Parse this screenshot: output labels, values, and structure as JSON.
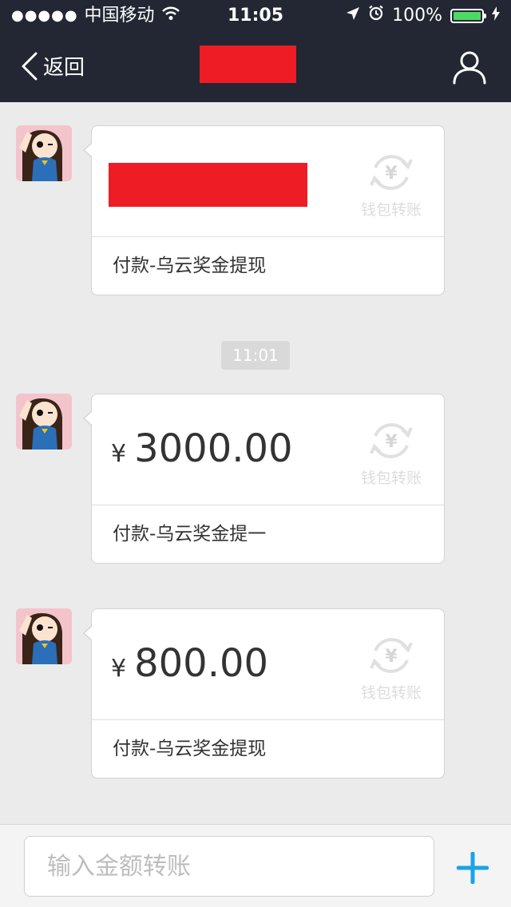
{
  "status_bar": {
    "signal": "●●●●●",
    "carrier": "中国移动",
    "time": "11:05",
    "battery_percent": "100%",
    "battery_level": 1.0,
    "battery_color": "#4cd964"
  },
  "nav": {
    "back_label": "返回",
    "title_redacted": true,
    "profile_icon": "person-icon",
    "background": "#232734"
  },
  "messages": [
    {
      "amount_yen": "",
      "amount": "",
      "redacted": true,
      "note": "付款-乌云奖金提现",
      "watermark": "钱包转账"
    },
    {
      "amount_yen": "¥",
      "amount": "3000.00",
      "redacted": false,
      "note": "付款-乌云奖金提一",
      "watermark": "钱包转账"
    },
    {
      "amount_yen": "¥",
      "amount": "800.00",
      "redacted": false,
      "note": "付款-乌云奖金提现",
      "watermark": "钱包转账"
    }
  ],
  "timestamp_chip": "11:01",
  "composer": {
    "placeholder": "输入金额转账",
    "value": "",
    "plus_icon": "plus-icon",
    "accent": "#1aa3e8"
  }
}
